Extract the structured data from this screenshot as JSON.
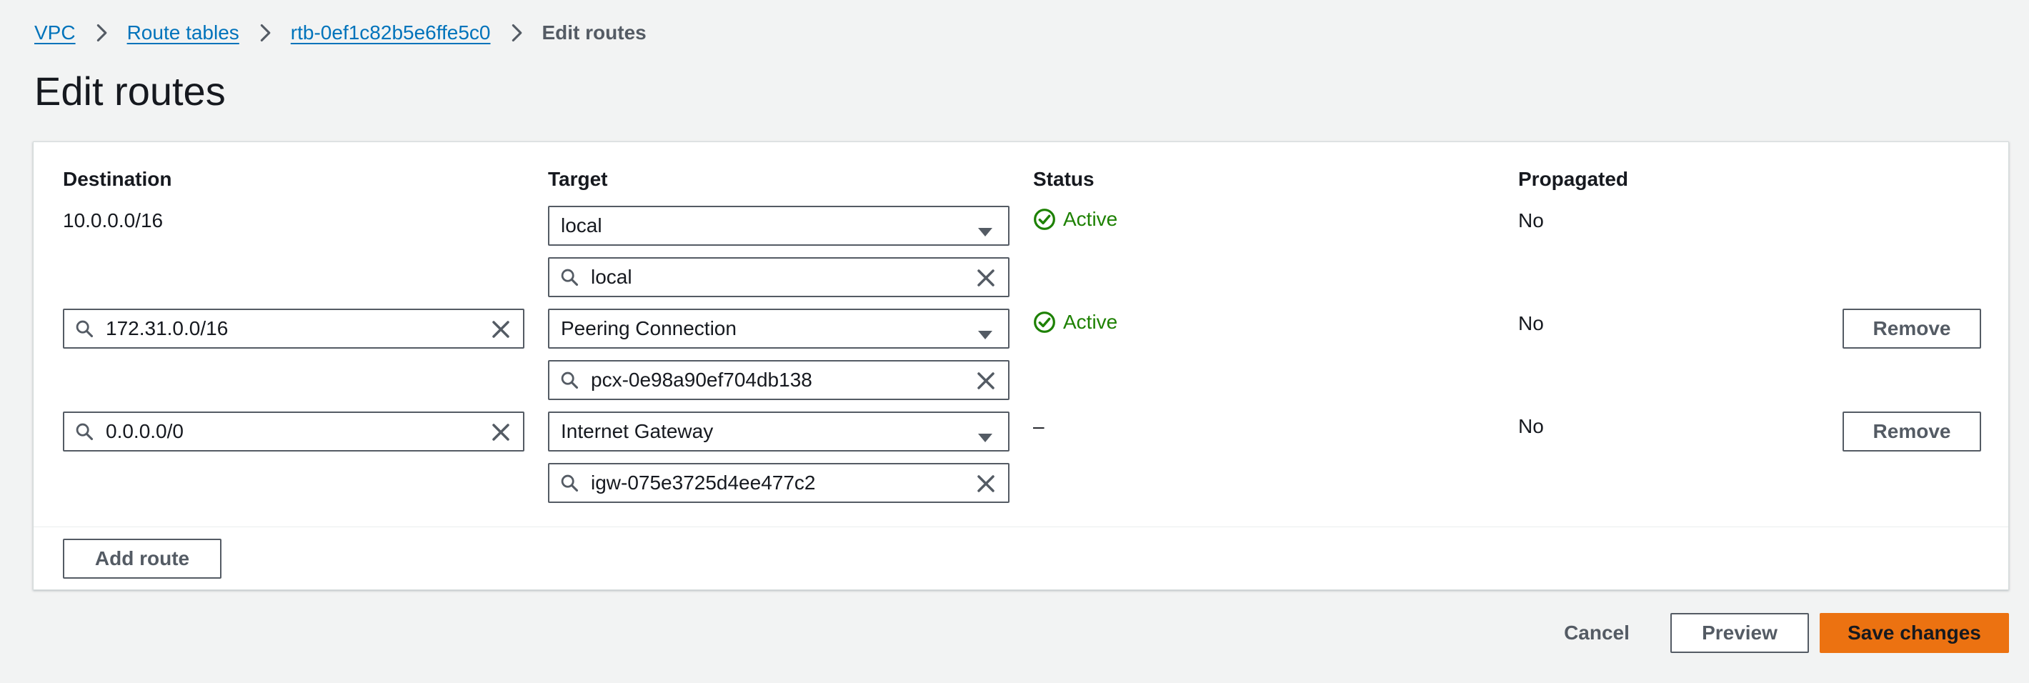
{
  "breadcrumb": {
    "items": [
      "VPC",
      "Route tables",
      "rtb-0ef1c82b5e6ffe5c0"
    ],
    "current": "Edit routes"
  },
  "page": {
    "title": "Edit routes"
  },
  "columns": {
    "destination": "Destination",
    "target": "Target",
    "status": "Status",
    "propagated": "Propagated"
  },
  "routes": [
    {
      "destination": "10.0.0.0/16",
      "target_type": "local",
      "target_id": "local",
      "status": "Active",
      "propagated": "No"
    },
    {
      "destination": "172.31.0.0/16",
      "target_type": "Peering Connection",
      "target_id": "pcx-0e98a90ef704db138",
      "status": "Active",
      "propagated": "No",
      "remove_label": "Remove"
    },
    {
      "destination": "0.0.0.0/0",
      "target_type": "Internet Gateway",
      "target_id": "igw-075e3725d4ee477c2",
      "status": "–",
      "propagated": "No",
      "remove_label": "Remove"
    }
  ],
  "actions": {
    "add_route": "Add route",
    "cancel": "Cancel",
    "preview": "Preview",
    "save": "Save changes"
  },
  "colors": {
    "link": "#0073bb",
    "active_status": "#1d8102",
    "primary_button": "#ec7211",
    "background": "#f2f3f3"
  },
  "icons": {
    "breadcrumb_separator": "chevron-right-icon",
    "status_active": "check-circle-icon",
    "search": "search-icon",
    "clear": "close-icon",
    "select": "caret-down-icon"
  }
}
